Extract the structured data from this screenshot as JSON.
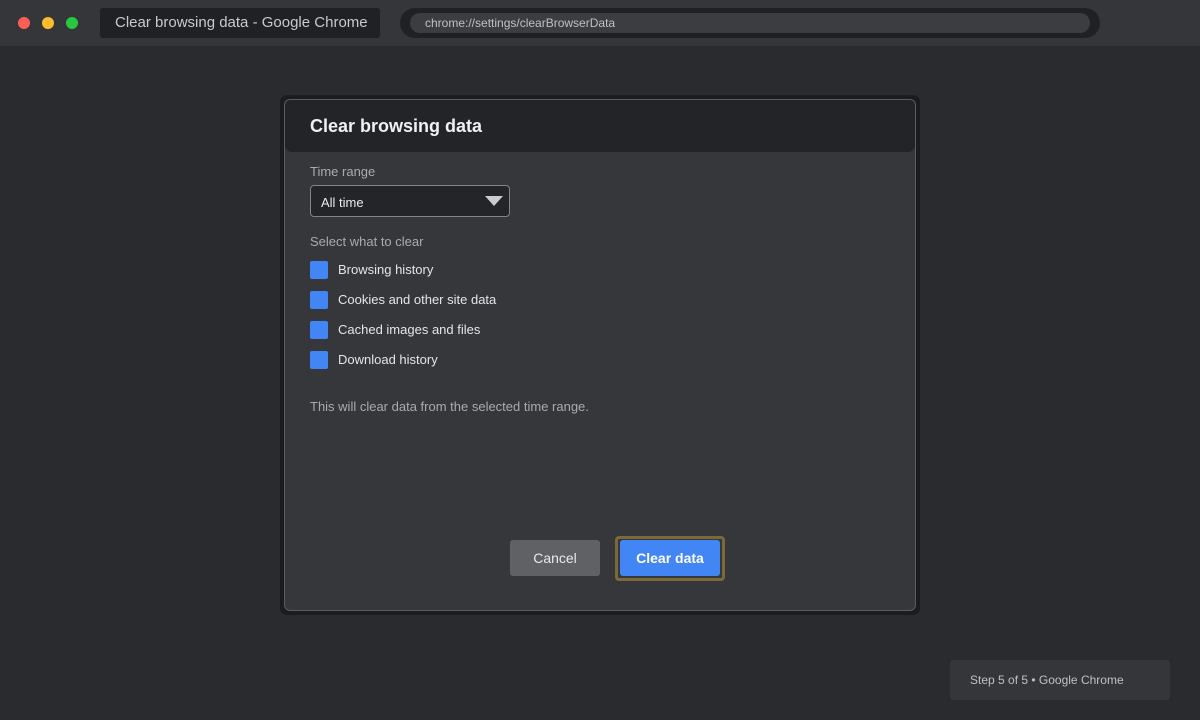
{
  "window": {
    "tab_title": "Clear browsing data - Google Chrome",
    "url": "chrome://settings/clearBrowserData",
    "controls": [
      "close",
      "minimize",
      "maximize"
    ]
  },
  "dialog": {
    "title": "Clear browsing data",
    "time_range": {
      "label": "Time range",
      "selected": "All time"
    },
    "select_label": "Select what to clear",
    "options": [
      {
        "label": "Browsing history",
        "checked": true
      },
      {
        "label": "Cookies and other site data",
        "checked": true
      },
      {
        "label": "Cached images and files",
        "checked": true
      },
      {
        "label": "Download history",
        "checked": true
      }
    ],
    "note": "This will clear data from the selected time range.",
    "buttons": {
      "cancel": "Cancel",
      "clear": "Clear data"
    }
  },
  "status": {
    "text": "Step 5 of 5 • Google Chrome"
  },
  "colors": {
    "accent": "#4285f4",
    "focus_ring": "#7a6a3a",
    "close": "#ff5f57",
    "minimize": "#febc2e",
    "maximize": "#28c840"
  }
}
